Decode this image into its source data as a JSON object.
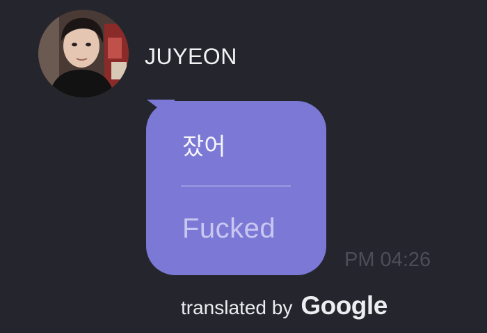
{
  "chat": {
    "sender": {
      "name": "JUYEON",
      "avatar_icon": "profile-photo"
    },
    "message": {
      "original_text": "잤어",
      "translated_text": "Fucked",
      "timestamp": "PM 04:26",
      "bubble_color": "#7c79d6"
    },
    "translation_attribution": {
      "prefix": "translated by",
      "brand": "Google"
    }
  },
  "colors": {
    "background": "#25262d",
    "bubble": "#7c79d6",
    "timestamp": "#4b4d58"
  }
}
